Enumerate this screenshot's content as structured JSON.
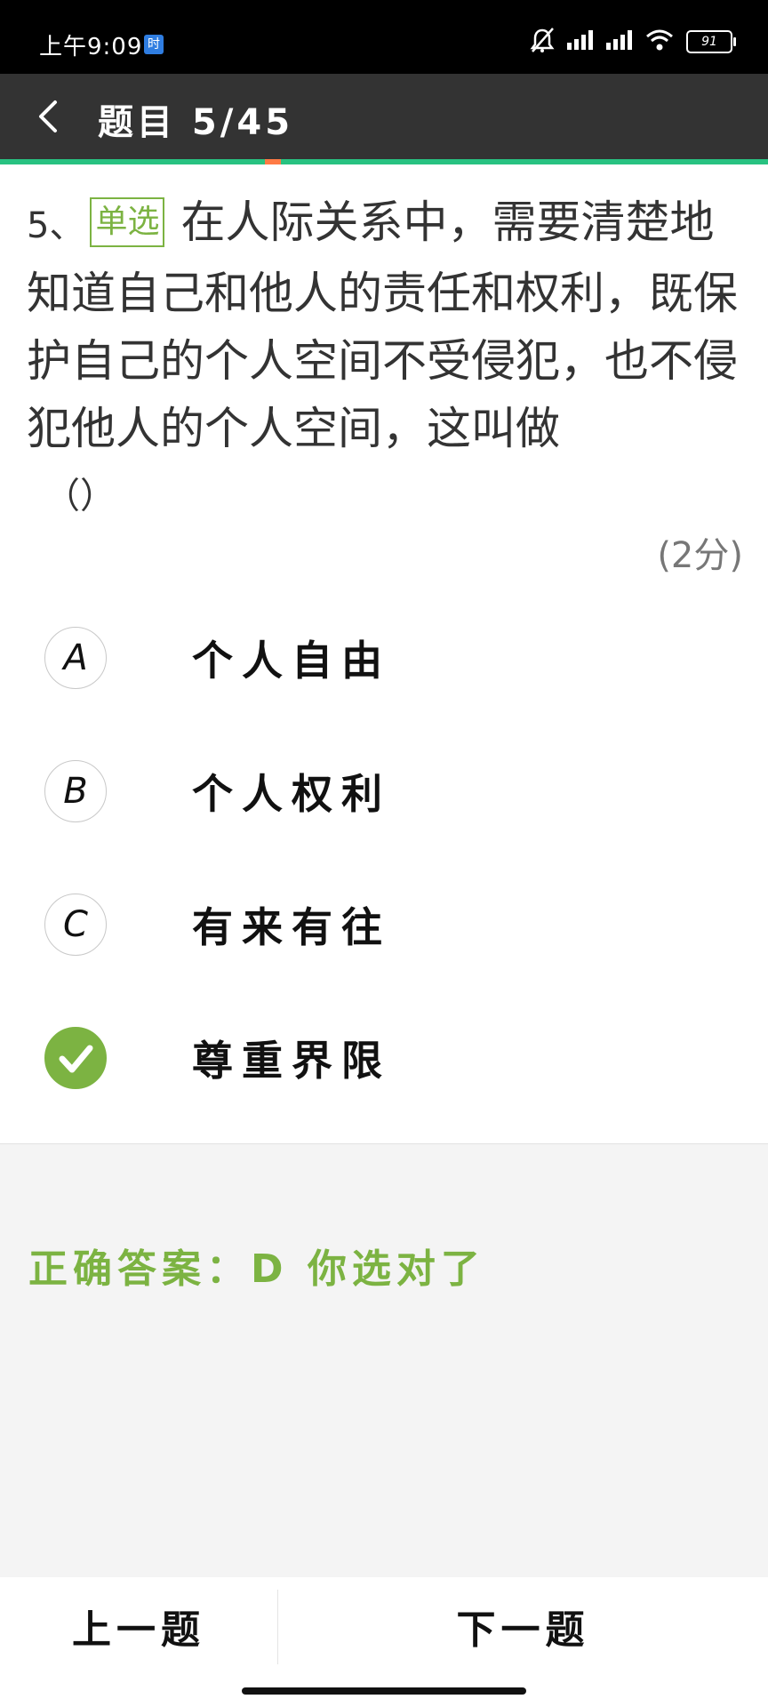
{
  "status_bar": {
    "time": "上午9:09",
    "badge": "时",
    "battery": "91"
  },
  "header": {
    "title": "题目 5/45"
  },
  "progress": {
    "current": 5,
    "total": 45,
    "track_color": "#28c281",
    "marker_color": "#ff7a45"
  },
  "question": {
    "number": "5、",
    "type_label": "单选",
    "text": "在人际关系中，需要清楚地知道自己和他人的责任和权利，既保护自己的个人空间不受侵犯，也不侵犯他人的个人空间，这叫做",
    "bracket": "（）",
    "score": "(2分)"
  },
  "options": [
    {
      "letter": "A",
      "text": "个人自由",
      "selected": false
    },
    {
      "letter": "B",
      "text": "个人权利",
      "selected": false
    },
    {
      "letter": "C",
      "text": "有来有往",
      "selected": false
    },
    {
      "letter": "D",
      "text": "尊重界限",
      "selected": true
    }
  ],
  "result": {
    "text": "正确答案：D 你选对了",
    "color": "#7cb342"
  },
  "footer": {
    "prev_label": "上一题",
    "next_label": "下一题"
  }
}
